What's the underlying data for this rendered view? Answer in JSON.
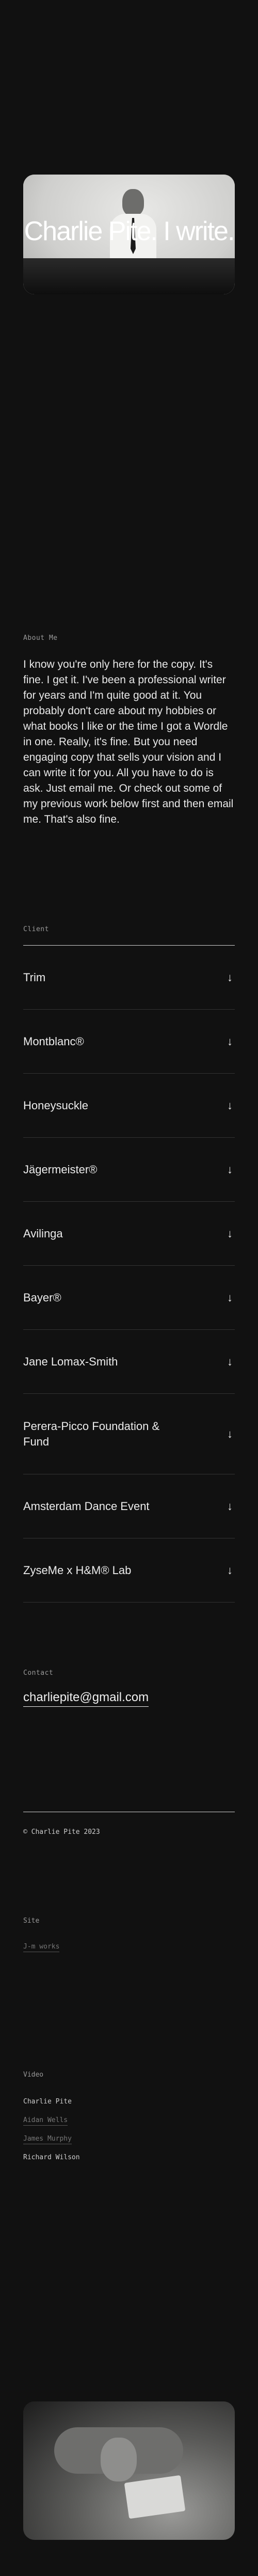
{
  "hero": {
    "title": "Charlie Pite. I write."
  },
  "about": {
    "label": "About Me",
    "text": "I know you're only here for the copy. It's fine. I get it. I've been a professional writer for years and I'm quite good at it. You probably don't care about my hobbies or what books I like or the time I got a Wordle in one. Really, it's fine. But you need engaging copy that sells your vision and I can write it for you. All you have to do is ask. Just email me. Or check out some of my previous work below first and then email me. That's also fine."
  },
  "clients": {
    "label": "Client",
    "arrow_glyph": "↓",
    "items": [
      "Trim",
      "Montblanc®",
      "Honeysuckle",
      "Jägermeister®",
      "Avilinga",
      "Bayer®",
      "Jane Lomax-Smith",
      "Perera-Picco Foundation & Fund",
      "Amsterdam Dance Event",
      "ZyseMe x H&M® Lab"
    ]
  },
  "contact": {
    "label": "Contact",
    "email": "charliepite@gmail.com"
  },
  "footer": {
    "copyright": "© Charlie Pite 2023",
    "site_label": "Site",
    "site_link": "J-m works",
    "video_label": "Video",
    "video_items": [
      "Charlie Pite",
      "Aidan Wells",
      "James Murphy",
      "Richard Wilson"
    ]
  },
  "icons": {
    "arrow": "arrow-down-icon"
  }
}
